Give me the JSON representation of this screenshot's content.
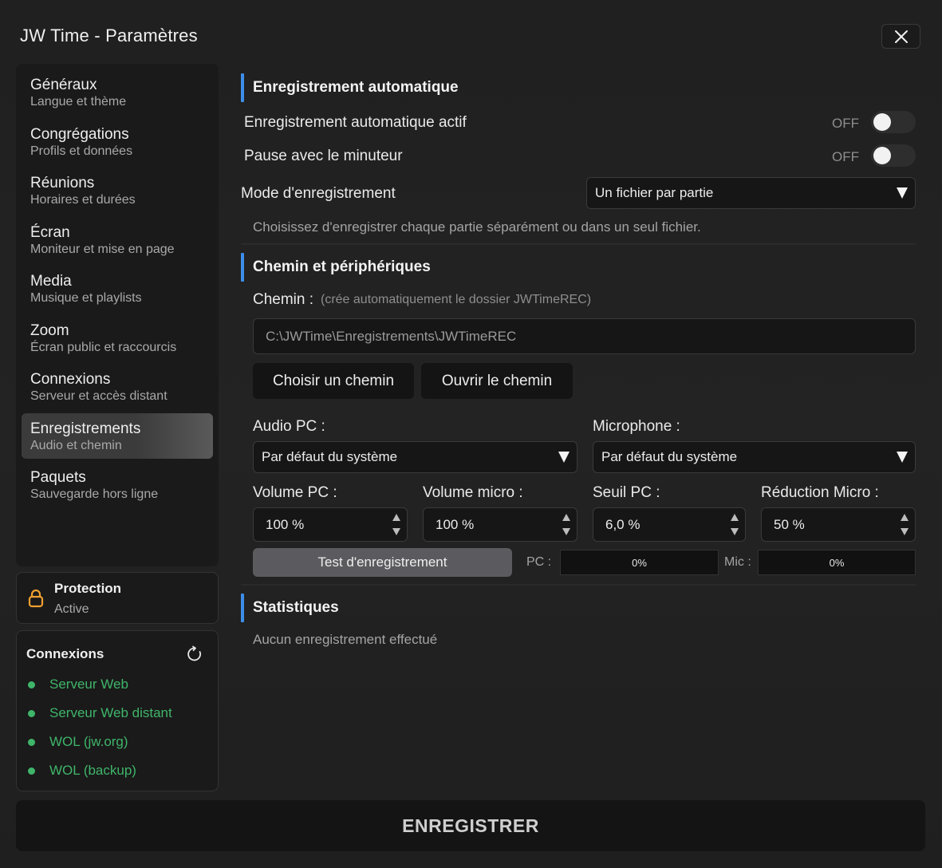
{
  "window": {
    "title": "JW Time - Paramètres"
  },
  "sidebar": {
    "items": [
      {
        "title": "Généraux",
        "subtitle": "Langue et thème"
      },
      {
        "title": "Congrégations",
        "subtitle": "Profils et données"
      },
      {
        "title": "Réunions",
        "subtitle": "Horaires et durées"
      },
      {
        "title": "Écran",
        "subtitle": "Moniteur et mise en page"
      },
      {
        "title": "Media",
        "subtitle": "Musique et playlists"
      },
      {
        "title": "Zoom",
        "subtitle": "Écran public et raccourcis"
      },
      {
        "title": "Connexions",
        "subtitle": "Serveur et accès distant"
      },
      {
        "title": "Enregistrements",
        "subtitle": "Audio et chemin"
      },
      {
        "title": "Paquets",
        "subtitle": "Sauvegarde hors ligne"
      }
    ],
    "active_index": 7
  },
  "protection": {
    "title": "Protection",
    "status": "Active",
    "icon": "lock-icon",
    "icon_color": "#f0a030"
  },
  "connexions": {
    "title": "Connexions",
    "status_color": "#3fb56a",
    "items": [
      "Serveur Web",
      "Serveur Web distant",
      "WOL (jw.org)",
      "WOL (backup)"
    ]
  },
  "auto_record": {
    "title": "Enregistrement automatique",
    "active_label": "Enregistrement automatique actif",
    "active_state": "OFF",
    "pause_label": "Pause avec le minuteur",
    "pause_state": "OFF",
    "mode_label": "Mode d'enregistrement",
    "mode_value": "Un fichier par partie",
    "mode_hint": "Choisissez d'enregistrer chaque partie séparément ou dans un seul fichier."
  },
  "path": {
    "title": "Chemin et périphériques",
    "label": "Chemin :",
    "note": "(crée automatiquement le dossier JWTimeREC)",
    "value": "C:\\JWTime\\Enregistrements\\JWTimeREC",
    "choose_btn": "Choisir un chemin",
    "open_btn": "Ouvrir le chemin"
  },
  "devices": {
    "audio_pc_label": "Audio PC :",
    "audio_pc_value": "Par défaut du système",
    "mic_label": "Microphone :",
    "mic_value": "Par défaut du système",
    "volume_pc_label": "Volume PC :",
    "volume_pc_value": "100 %",
    "volume_mic_label": "Volume micro :",
    "volume_mic_value": "100 %",
    "threshold_pc_label": "Seuil PC :",
    "threshold_pc_value": "6,0 %",
    "mic_reduction_label": "Réduction Micro :",
    "mic_reduction_value": "50 %",
    "test_btn": "Test d'enregistrement",
    "pc_meter_label": "PC :",
    "pc_meter_value": "0%",
    "mic_meter_label": "Mic :",
    "mic_meter_value": "0%"
  },
  "stats": {
    "title": "Statistiques",
    "empty": "Aucun enregistrement effectué"
  },
  "footer": {
    "save_label": "ENREGISTRER"
  },
  "colors": {
    "accent": "#3d8ee8",
    "online": "#3fb56a"
  }
}
